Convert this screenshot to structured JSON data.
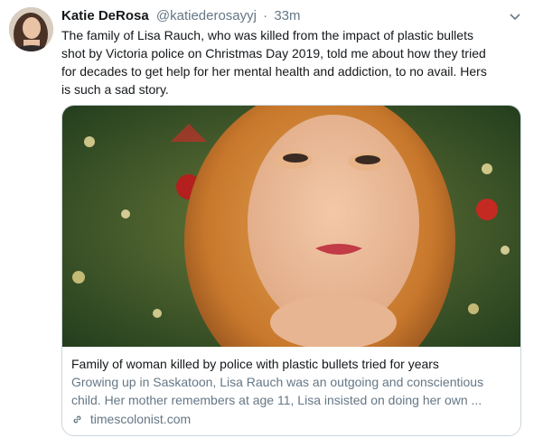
{
  "tweet": {
    "author_name": "Katie DeRosa",
    "author_handle": "@katiederosayyj",
    "separator": "·",
    "timestamp": "33m",
    "text_lines": [
      "The family of Lisa Rauch, who was killed from the impact of plastic bullets",
      "shot by Victoria police on Christmas Day 2019, told me about how they tried",
      "for decades to get help for her mental health and addiction, to no avail. Hers",
      "is such a sad story."
    ]
  },
  "card": {
    "title": "Family of woman killed by police with plastic bullets tried for years",
    "description_lines": [
      "Growing up in Saskatoon, Lisa Rauch was an outgoing and conscientious",
      "child. Her mother remembers at age 11, Lisa insisted on doing her own ..."
    ],
    "domain": "timescolonist.com"
  },
  "icons": {
    "menu": "chevron-down-icon",
    "link": "link-icon"
  },
  "colors": {
    "text_primary": "#14171a",
    "text_secondary": "#657786",
    "card_border": "#ccd6dd"
  }
}
